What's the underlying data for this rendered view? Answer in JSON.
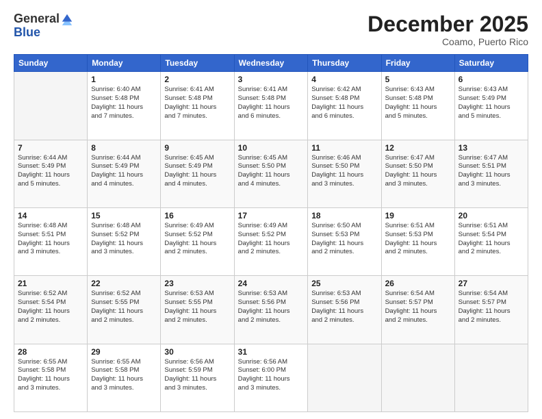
{
  "header": {
    "logo_general": "General",
    "logo_blue": "Blue",
    "month": "December 2025",
    "location": "Coamo, Puerto Rico"
  },
  "days_of_week": [
    "Sunday",
    "Monday",
    "Tuesday",
    "Wednesday",
    "Thursday",
    "Friday",
    "Saturday"
  ],
  "weeks": [
    [
      {
        "day": "",
        "info": ""
      },
      {
        "day": "1",
        "info": "Sunrise: 6:40 AM\nSunset: 5:48 PM\nDaylight: 11 hours\nand 7 minutes."
      },
      {
        "day": "2",
        "info": "Sunrise: 6:41 AM\nSunset: 5:48 PM\nDaylight: 11 hours\nand 7 minutes."
      },
      {
        "day": "3",
        "info": "Sunrise: 6:41 AM\nSunset: 5:48 PM\nDaylight: 11 hours\nand 6 minutes."
      },
      {
        "day": "4",
        "info": "Sunrise: 6:42 AM\nSunset: 5:48 PM\nDaylight: 11 hours\nand 6 minutes."
      },
      {
        "day": "5",
        "info": "Sunrise: 6:43 AM\nSunset: 5:48 PM\nDaylight: 11 hours\nand 5 minutes."
      },
      {
        "day": "6",
        "info": "Sunrise: 6:43 AM\nSunset: 5:49 PM\nDaylight: 11 hours\nand 5 minutes."
      }
    ],
    [
      {
        "day": "7",
        "info": "Sunrise: 6:44 AM\nSunset: 5:49 PM\nDaylight: 11 hours\nand 5 minutes."
      },
      {
        "day": "8",
        "info": "Sunrise: 6:44 AM\nSunset: 5:49 PM\nDaylight: 11 hours\nand 4 minutes."
      },
      {
        "day": "9",
        "info": "Sunrise: 6:45 AM\nSunset: 5:49 PM\nDaylight: 11 hours\nand 4 minutes."
      },
      {
        "day": "10",
        "info": "Sunrise: 6:45 AM\nSunset: 5:50 PM\nDaylight: 11 hours\nand 4 minutes."
      },
      {
        "day": "11",
        "info": "Sunrise: 6:46 AM\nSunset: 5:50 PM\nDaylight: 11 hours\nand 3 minutes."
      },
      {
        "day": "12",
        "info": "Sunrise: 6:47 AM\nSunset: 5:50 PM\nDaylight: 11 hours\nand 3 minutes."
      },
      {
        "day": "13",
        "info": "Sunrise: 6:47 AM\nSunset: 5:51 PM\nDaylight: 11 hours\nand 3 minutes."
      }
    ],
    [
      {
        "day": "14",
        "info": "Sunrise: 6:48 AM\nSunset: 5:51 PM\nDaylight: 11 hours\nand 3 minutes."
      },
      {
        "day": "15",
        "info": "Sunrise: 6:48 AM\nSunset: 5:52 PM\nDaylight: 11 hours\nand 3 minutes."
      },
      {
        "day": "16",
        "info": "Sunrise: 6:49 AM\nSunset: 5:52 PM\nDaylight: 11 hours\nand 2 minutes."
      },
      {
        "day": "17",
        "info": "Sunrise: 6:49 AM\nSunset: 5:52 PM\nDaylight: 11 hours\nand 2 minutes."
      },
      {
        "day": "18",
        "info": "Sunrise: 6:50 AM\nSunset: 5:53 PM\nDaylight: 11 hours\nand 2 minutes."
      },
      {
        "day": "19",
        "info": "Sunrise: 6:51 AM\nSunset: 5:53 PM\nDaylight: 11 hours\nand 2 minutes."
      },
      {
        "day": "20",
        "info": "Sunrise: 6:51 AM\nSunset: 5:54 PM\nDaylight: 11 hours\nand 2 minutes."
      }
    ],
    [
      {
        "day": "21",
        "info": "Sunrise: 6:52 AM\nSunset: 5:54 PM\nDaylight: 11 hours\nand 2 minutes."
      },
      {
        "day": "22",
        "info": "Sunrise: 6:52 AM\nSunset: 5:55 PM\nDaylight: 11 hours\nand 2 minutes."
      },
      {
        "day": "23",
        "info": "Sunrise: 6:53 AM\nSunset: 5:55 PM\nDaylight: 11 hours\nand 2 minutes."
      },
      {
        "day": "24",
        "info": "Sunrise: 6:53 AM\nSunset: 5:56 PM\nDaylight: 11 hours\nand 2 minutes."
      },
      {
        "day": "25",
        "info": "Sunrise: 6:53 AM\nSunset: 5:56 PM\nDaylight: 11 hours\nand 2 minutes."
      },
      {
        "day": "26",
        "info": "Sunrise: 6:54 AM\nSunset: 5:57 PM\nDaylight: 11 hours\nand 2 minutes."
      },
      {
        "day": "27",
        "info": "Sunrise: 6:54 AM\nSunset: 5:57 PM\nDaylight: 11 hours\nand 2 minutes."
      }
    ],
    [
      {
        "day": "28",
        "info": "Sunrise: 6:55 AM\nSunset: 5:58 PM\nDaylight: 11 hours\nand 3 minutes."
      },
      {
        "day": "29",
        "info": "Sunrise: 6:55 AM\nSunset: 5:58 PM\nDaylight: 11 hours\nand 3 minutes."
      },
      {
        "day": "30",
        "info": "Sunrise: 6:56 AM\nSunset: 5:59 PM\nDaylight: 11 hours\nand 3 minutes."
      },
      {
        "day": "31",
        "info": "Sunrise: 6:56 AM\nSunset: 6:00 PM\nDaylight: 11 hours\nand 3 minutes."
      },
      {
        "day": "",
        "info": ""
      },
      {
        "day": "",
        "info": ""
      },
      {
        "day": "",
        "info": ""
      }
    ]
  ]
}
